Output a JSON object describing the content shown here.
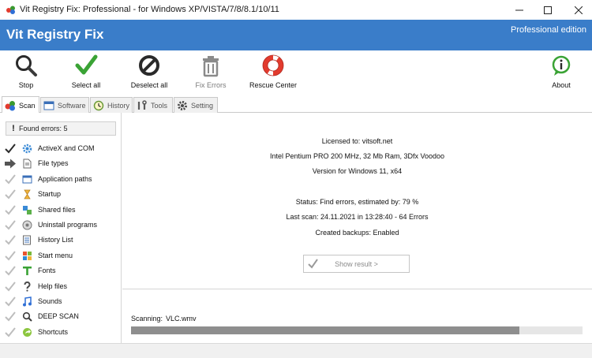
{
  "window": {
    "title": "Vit Registry Fix: Professional - for Windows XP/VISTA/7/8/8.1/10/11",
    "controls": {
      "minimize": "—",
      "maximize": "☐",
      "close": "✕"
    }
  },
  "header": {
    "title": "Vit Registry Fix",
    "edition": "Professional edition",
    "color": "#3a7dc9"
  },
  "toolbar": {
    "stop": "Stop",
    "select_all": "Select all",
    "deselect_all": "Deselect all",
    "fix_errors": "Fix Errors",
    "rescue_center": "Rescue Center",
    "about": "About"
  },
  "tabs": [
    {
      "label": "Scan",
      "icon": "scan-icon",
      "active": true
    },
    {
      "label": "Software",
      "icon": "software-icon"
    },
    {
      "label": "History",
      "icon": "history-icon"
    },
    {
      "label": "Tools",
      "icon": "tools-icon"
    },
    {
      "label": "Setting",
      "icon": "setting-icon"
    }
  ],
  "left": {
    "found": "Found errors: 5",
    "categories": [
      {
        "label": "ActiveX and COM",
        "icon": "gear-icon",
        "state": "checked"
      },
      {
        "label": "File types",
        "icon": "file-icon",
        "state": "current"
      },
      {
        "label": "Application paths",
        "icon": "window-icon",
        "state": "pending"
      },
      {
        "label": "Startup",
        "icon": "hourglass-icon",
        "state": "pending"
      },
      {
        "label": "Shared files",
        "icon": "shared-files-icon",
        "state": "pending"
      },
      {
        "label": "Uninstall programs",
        "icon": "uninstall-icon",
        "state": "pending"
      },
      {
        "label": "History List",
        "icon": "history-list-icon",
        "state": "pending"
      },
      {
        "label": "Start menu",
        "icon": "windows-logo-icon",
        "state": "pending"
      },
      {
        "label": "Fonts",
        "icon": "font-icon",
        "state": "pending"
      },
      {
        "label": "Help files",
        "icon": "question-icon",
        "state": "pending"
      },
      {
        "label": "Sounds",
        "icon": "music-note-icon",
        "state": "pending"
      },
      {
        "label": "DEEP SCAN",
        "icon": "magnifier-icon",
        "state": "pending"
      },
      {
        "label": "Shortcuts",
        "icon": "shortcut-icon",
        "state": "pending"
      }
    ]
  },
  "info": {
    "licensed": "Licensed to: vitsoft.net",
    "hardware": "Intel Pentium PRO 200 MHz, 32 Mb Ram, 3Dfx Voodoo",
    "version": "Version for Windows 11, x64",
    "status": "Status: Find errors, estimated by: 79 %",
    "last_scan": "Last scan: 24.11.2021 in 13:28:40 - 64 Errors",
    "backups": "Created backups: Enabled",
    "show_result": "Show result >"
  },
  "scan": {
    "label": "Scanning:",
    "file": "VLC.wmv",
    "progress": 0.86
  }
}
